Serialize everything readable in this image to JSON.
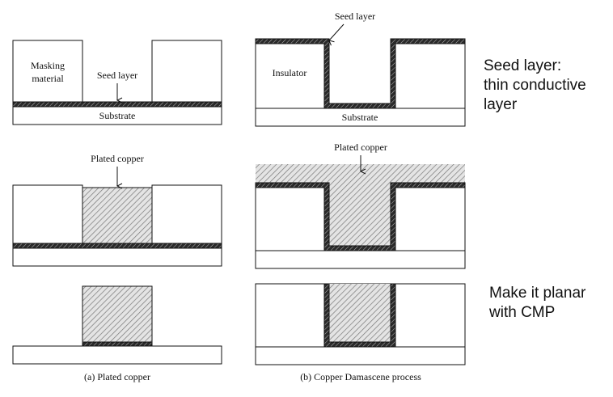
{
  "labels": {
    "masking_material": [
      "Masking",
      "material"
    ],
    "seed_layer": "Seed layer",
    "substrate": "Substrate",
    "insulator": "Insulator",
    "plated_copper": "Plated copper"
  },
  "captions": {
    "a": "(a) Plated copper",
    "b": "(b) Copper Damascene process"
  },
  "notes": {
    "seed": "Seed layer:\nthin conductive\nlayer",
    "cmp": "Make it planar\nwith CMP"
  },
  "colors": {
    "line": "#111111",
    "seed_fill": "#3a3a3a",
    "copper_hatch": "#6b6b6b",
    "copper_bg": "#e4e4e4"
  }
}
